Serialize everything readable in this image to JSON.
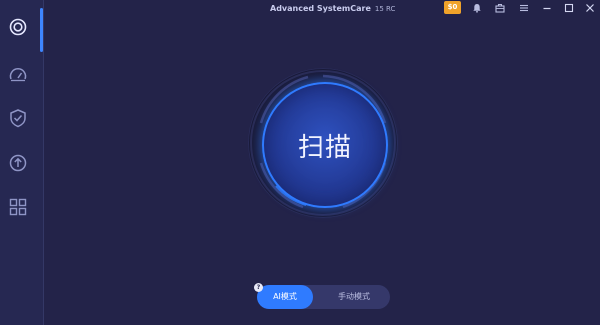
{
  "window": {
    "title": "Advanced SystemCare",
    "version": "15 RC",
    "badge": "$0"
  },
  "icons": {
    "sidebar": [
      "care-icon",
      "speedometer-icon",
      "shield-icon",
      "update-icon",
      "toolbox-icon"
    ],
    "titlebar": [
      "offer-badge",
      "bell-icon",
      "briefcase-icon",
      "menu-icon",
      "minimize-icon",
      "maximize-icon",
      "close-icon"
    ]
  },
  "main": {
    "scan_label": "扫描"
  },
  "mode_switch": {
    "help": "?",
    "ai_mode": "AI模式",
    "manual_mode": "手动模式",
    "selected": "ai_mode"
  },
  "colors": {
    "background": "#232349",
    "sidebar": "#262852",
    "accent": "#2f7bff",
    "badge": "#f0a32a"
  }
}
